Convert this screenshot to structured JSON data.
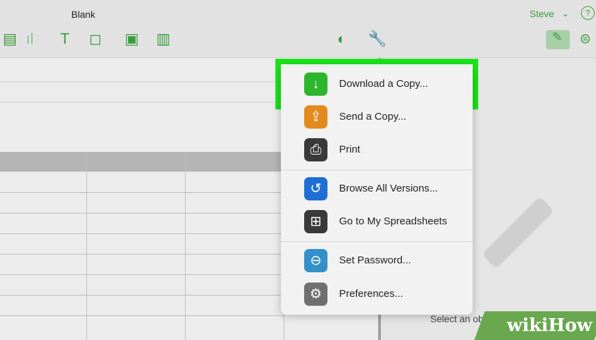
{
  "document": {
    "title": "Blank"
  },
  "user": {
    "name": "Steve",
    "help_glyph": "?"
  },
  "toolbar": {
    "icons": [
      "table-icon",
      "chart-icon",
      "text-icon",
      "shape-icon",
      "media-icon",
      "comment-icon",
      "collaborate-icon",
      "wrench-icon",
      "format-brush-icon",
      "organize-icon"
    ]
  },
  "menu": {
    "items": [
      {
        "label": "Download a Copy...",
        "icon": "download-icon",
        "color": "#2db52d"
      },
      {
        "label": "Send a Copy...",
        "icon": "send-copy-icon",
        "color": "#e38a1e"
      },
      {
        "label": "Print",
        "icon": "print-icon",
        "color": "#3a3a3a"
      },
      {
        "label": "Browse All Versions...",
        "icon": "versions-icon",
        "color": "#1f6ed4"
      },
      {
        "label": "Go to My Spreadsheets",
        "icon": "spreadsheets-icon",
        "color": "#3a3a3a"
      },
      {
        "label": "Set Password...",
        "icon": "lock-icon",
        "color": "#3490c9"
      },
      {
        "label": "Preferences...",
        "icon": "gear-icon",
        "color": "#707070"
      }
    ]
  },
  "panel": {
    "hint": "Select an object to format."
  },
  "watermark": {
    "text": "wikiHow"
  },
  "colors": {
    "highlight": "#19e219",
    "accent": "#3d9b3d"
  }
}
